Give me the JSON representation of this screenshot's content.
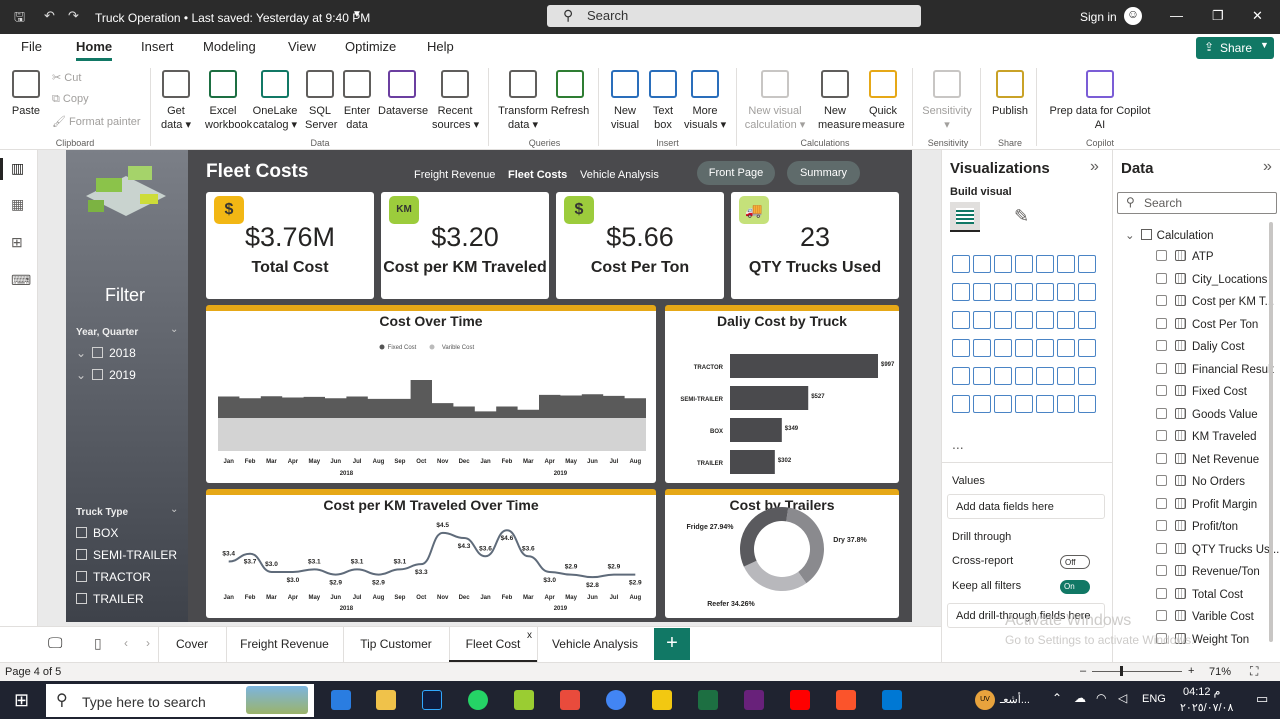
{
  "titlebar": {
    "doc_title": "Truck Operation  •  Last saved: Yesterday at 9:40 PM",
    "search": "Search",
    "signin": "Sign in"
  },
  "menu": {
    "tabs": [
      "File",
      "Home",
      "Insert",
      "Modeling",
      "View",
      "Optimize",
      "Help"
    ],
    "share": "Share"
  },
  "ribbon": {
    "paste": "Paste",
    "cut": "Cut",
    "copy": "Copy",
    "format_painter": "Format painter",
    "buttons": [
      {
        "label": "Get\ndata ▾"
      },
      {
        "label": "Excel\nworkbook"
      },
      {
        "label": "OneLake\ncatalog ▾"
      },
      {
        "label": "SQL\nServer"
      },
      {
        "label": "Enter\ndata"
      },
      {
        "label": "Dataverse"
      },
      {
        "label": "Recent\nsources ▾"
      },
      {
        "label": "Transform\ndata ▾"
      },
      {
        "label": "Refresh"
      },
      {
        "label": "New\nvisual"
      },
      {
        "label": "Text\nbox"
      },
      {
        "label": "More\nvisuals ▾"
      },
      {
        "label": "New visual\ncalculation ▾"
      },
      {
        "label": "New\nmeasure"
      },
      {
        "label": "Quick\nmeasure"
      },
      {
        "label": "Sensitivity\n▾"
      },
      {
        "label": "Publish"
      },
      {
        "label": "Prep data for Copilot\nAI"
      }
    ],
    "groups": [
      "Clipboard",
      "Data",
      "Queries",
      "Insert",
      "Calculations",
      "Sensitivity",
      "Share",
      "Copilot"
    ]
  },
  "report": {
    "title": "Fleet Costs",
    "nav": [
      "Freight Revenue",
      "Fleet Costs",
      "Vehicle Analysis"
    ],
    "pills": [
      "Front Page",
      "Summary"
    ],
    "filter": {
      "title": "Filter",
      "year_label": "Year, Quarter",
      "years": [
        "2018",
        "2019"
      ],
      "truck_label": "Truck Type",
      "truck_types": [
        "BOX",
        "SEMI-TRAILER",
        "TRACTOR",
        "TRAILER"
      ]
    },
    "kpis": [
      {
        "value": "$3.76M",
        "label": "Total Cost",
        "icon": "$"
      },
      {
        "value": "$3.20",
        "label": "Cost per KM Traveled",
        "icon": "KM"
      },
      {
        "value": "$5.66",
        "label": "Cost Per Ton",
        "icon": "$"
      },
      {
        "value": "23",
        "label": "QTY Trucks Used",
        "icon": "🚚"
      }
    ]
  },
  "chart_data": [
    {
      "type": "area",
      "title": "Cost Over Time",
      "legend": [
        "Fixed Cost",
        "Varible Cost"
      ],
      "categories": [
        "Jan",
        "Feb",
        "Mar",
        "Apr",
        "May",
        "Jun",
        "Jul",
        "Aug",
        "Sep",
        "Oct",
        "Nov",
        "Dec",
        "Jan",
        "Feb",
        "Mar",
        "Apr",
        "May",
        "Jun",
        "Jul",
        "Aug"
      ],
      "years": [
        "2018",
        "2019"
      ],
      "series": [
        {
          "name": "Fixed Cost",
          "values": [
            0.55,
            0.55,
            0.55,
            0.55,
            0.55,
            0.55,
            0.55,
            0.55,
            0.55,
            0.55,
            0.55,
            0.55,
            0.55,
            0.55,
            0.55,
            0.55,
            0.55,
            0.55,
            0.55,
            0.55
          ]
        },
        {
          "name": "Varible Cost",
          "values": [
            0.65,
            0.6,
            0.66,
            0.62,
            0.64,
            0.6,
            0.65,
            0.58,
            0.58,
            1.15,
            0.45,
            0.35,
            0.2,
            0.35,
            0.25,
            0.7,
            0.68,
            0.72,
            0.67,
            0.6
          ]
        }
      ]
    },
    {
      "type": "bar",
      "title": "Daliy Cost by Truck",
      "categories": [
        "TRACTOR",
        "SEMI-TRAILER",
        "BOX",
        "TRAILER"
      ],
      "values": [
        997,
        527,
        349,
        302
      ],
      "labels": [
        "$997",
        "$527",
        "$349",
        "$302"
      ]
    },
    {
      "type": "line",
      "title": "Cost per KM Traveled Over Time",
      "categories": [
        "Jan",
        "Feb",
        "Mar",
        "Apr",
        "May",
        "Jun",
        "Jul",
        "Aug",
        "Sep",
        "Oct",
        "Nov",
        "Dec",
        "Jan",
        "Feb",
        "Mar",
        "Apr",
        "May",
        "Jun",
        "Jul",
        "Aug"
      ],
      "years": [
        "2018",
        "2019"
      ],
      "values": [
        3.4,
        3.7,
        3.0,
        3.0,
        3.1,
        2.9,
        3.1,
        2.9,
        3.1,
        3.3,
        4.5,
        4.3,
        3.6,
        4.6,
        3.6,
        3.0,
        2.9,
        2.8,
        2.9,
        2.9
      ],
      "labels": [
        "$3.4",
        "$3.7",
        "$3.0",
        "$3.0",
        "$3.1",
        "$2.9",
        "$3.1",
        "$2.9",
        "$3.1",
        "$3.3",
        "$4.5",
        "$4.3",
        "$3.6",
        "$4.6",
        "$3.6",
        "$3.0",
        "$2.9",
        "$2.8",
        "$2.9",
        "$2.9"
      ]
    },
    {
      "type": "pie",
      "title": "Cost by Trailers",
      "categories": [
        "Dry",
        "Fridge",
        "Reefer"
      ],
      "values": [
        37.8,
        27.94,
        34.26
      ],
      "labels": [
        "Dry 37.8%",
        "Fridge 27.94%",
        "Reefer 34.26%"
      ]
    }
  ],
  "viz_pane": {
    "title": "Visualizations",
    "build_visual": "Build visual",
    "values": "Values",
    "add_fields": "Add data fields here",
    "drill_through": "Drill through",
    "cross_report": "Cross-report",
    "cross_report_state": "Off",
    "keep_filters": "Keep all filters",
    "keep_filters_state": "On",
    "add_drill": "Add drill-through fields here",
    "more": "..."
  },
  "data_pane": {
    "title": "Data",
    "search": "Search",
    "table": "Calculation",
    "fields": [
      "ATP",
      "City_Locations",
      "Cost per KM T...",
      "Cost Per Ton",
      "Daliy Cost",
      "Financial Result",
      "Fixed Cost",
      "Goods Value",
      "KM Traveled",
      "Net Revenue",
      "No Orders",
      "Profit Margin",
      "Profit/ton",
      "QTY Trucks Us...",
      "Revenue/Ton",
      "Total Cost",
      "Varible Cost",
      "Weight Ton"
    ]
  },
  "page_tabs": [
    "Cover",
    "Freight Revenue",
    "Tip Customer",
    "Fleet Cost",
    "Vehicle Analysis"
  ],
  "status": {
    "page": "Page 4 of 5",
    "zoom": "71%"
  },
  "watermark": {
    "line1": "Activate Windows",
    "line2": "Go to Settings to activate Windows."
  },
  "taskbar": {
    "search": "Type here to search",
    "time": "04:12 م",
    "date": "٢٠٢٥/٠٧/٠٨",
    "lang": "ENG",
    "weather": "أشعـ..."
  }
}
